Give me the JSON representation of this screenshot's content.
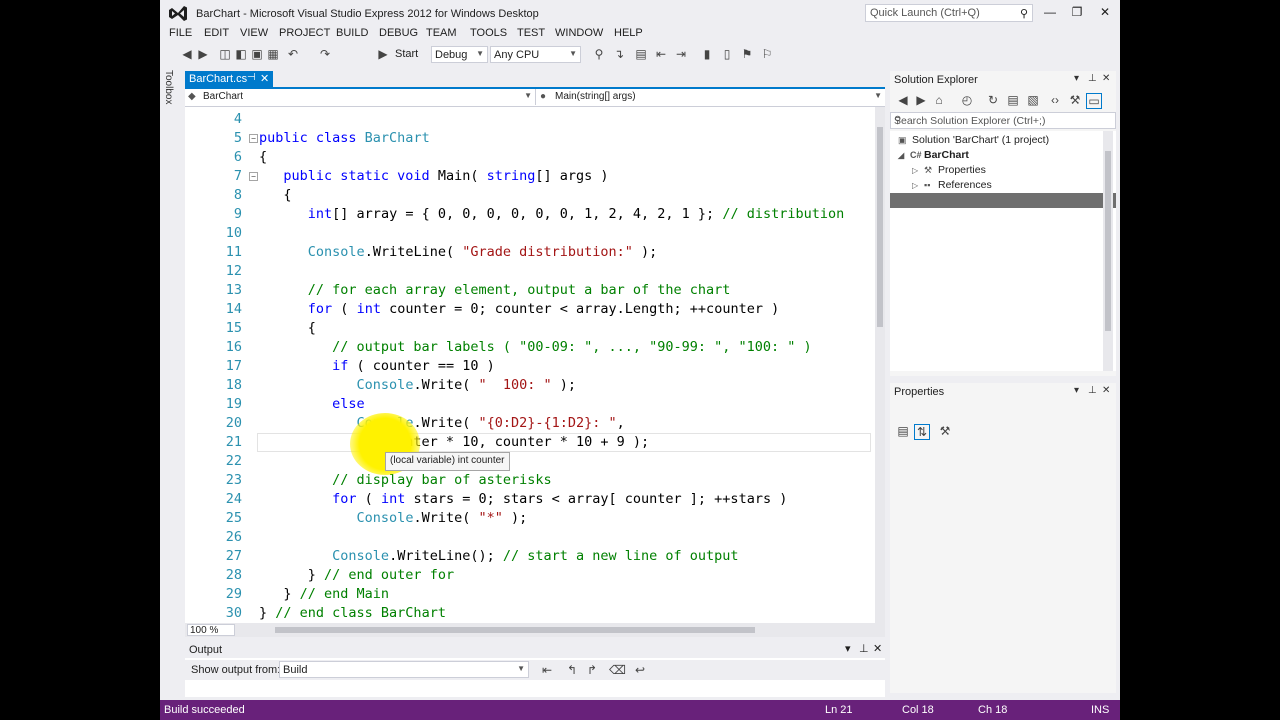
{
  "window": {
    "title": "BarChart - Microsoft Visual Studio Express 2012 for Windows Desktop",
    "quick_launch_placeholder": "Quick Launch (Ctrl+Q)",
    "minimize": "—",
    "restore": "❐",
    "close": "✕"
  },
  "menu": [
    "FILE",
    "EDIT",
    "VIEW",
    "PROJECT",
    "BUILD",
    "DEBUG",
    "TEAM",
    "TOOLS",
    "TEST",
    "WINDOW",
    "HELP"
  ],
  "toolbar": {
    "start_label": "Start",
    "config": "Debug",
    "platform": "Any CPU"
  },
  "toolbox_label": "Toolbox",
  "document_tab": {
    "name": "BarChart.cs",
    "pin": "⊣",
    "close": "✕"
  },
  "navbar": {
    "type": "BarChart",
    "member": "Main(string[] args)"
  },
  "editor": {
    "zoom": "100 %",
    "current_line": 21,
    "tooltip": "(local variable) int counter",
    "lines": [
      {
        "n": "4",
        "fold": "",
        "tokens": []
      },
      {
        "n": "5",
        "fold": "−",
        "tokens": [
          [
            "kw",
            "public class "
          ],
          [
            "ty",
            "BarChart"
          ]
        ]
      },
      {
        "n": "6",
        "fold": "",
        "tokens": [
          [
            "p",
            "{"
          ]
        ]
      },
      {
        "n": "7",
        "fold": "−",
        "tokens": [
          [
            "p",
            "   "
          ],
          [
            "kw",
            "public static void "
          ],
          [
            "p",
            "Main( "
          ],
          [
            "kw",
            "string"
          ],
          [
            "p",
            "[] args )"
          ]
        ]
      },
      {
        "n": "8",
        "fold": "",
        "tokens": [
          [
            "p",
            "   {"
          ]
        ]
      },
      {
        "n": "9",
        "fold": "",
        "tokens": [
          [
            "p",
            "      "
          ],
          [
            "kw",
            "int"
          ],
          [
            "p",
            "[] array = { 0, 0, 0, 0, 0, 0, 1, 2, 4, 2, 1 }; "
          ],
          [
            "cm",
            "// distribution"
          ]
        ]
      },
      {
        "n": "10",
        "fold": "",
        "tokens": []
      },
      {
        "n": "11",
        "fold": "",
        "tokens": [
          [
            "p",
            "      "
          ],
          [
            "ty",
            "Console"
          ],
          [
            "p",
            ".WriteLine( "
          ],
          [
            "st",
            "\"Grade distribution:\""
          ],
          [
            "p",
            " );"
          ]
        ]
      },
      {
        "n": "12",
        "fold": "",
        "tokens": []
      },
      {
        "n": "13",
        "fold": "",
        "tokens": [
          [
            "p",
            "      "
          ],
          [
            "cm",
            "// for each array element, output a bar of the chart"
          ]
        ]
      },
      {
        "n": "14",
        "fold": "",
        "tokens": [
          [
            "p",
            "      "
          ],
          [
            "kw",
            "for"
          ],
          [
            "p",
            " ( "
          ],
          [
            "kw",
            "int"
          ],
          [
            "p",
            " counter = 0; counter < array.Length; ++counter )"
          ]
        ]
      },
      {
        "n": "15",
        "fold": "",
        "tokens": [
          [
            "p",
            "      {"
          ]
        ]
      },
      {
        "n": "16",
        "fold": "",
        "tokens": [
          [
            "p",
            "         "
          ],
          [
            "cm",
            "// output bar labels ( \"00-09: \", ..., \"90-99: \", \"100: \" )"
          ]
        ]
      },
      {
        "n": "17",
        "fold": "",
        "tokens": [
          [
            "p",
            "         "
          ],
          [
            "kw",
            "if"
          ],
          [
            "p",
            " ( counter == 10 )"
          ]
        ]
      },
      {
        "n": "18",
        "fold": "",
        "tokens": [
          [
            "p",
            "            "
          ],
          [
            "ty",
            "Console"
          ],
          [
            "p",
            ".Write( "
          ],
          [
            "st",
            "\"  100: \""
          ],
          [
            "p",
            " );"
          ]
        ]
      },
      {
        "n": "19",
        "fold": "",
        "tokens": [
          [
            "p",
            "         "
          ],
          [
            "kw",
            "else"
          ]
        ]
      },
      {
        "n": "20",
        "fold": "",
        "tokens": [
          [
            "p",
            "            "
          ],
          [
            "ty",
            "Console"
          ],
          [
            "p",
            ".Write( "
          ],
          [
            "st",
            "\"{0:D2}-{1:D2}: \""
          ],
          [
            "p",
            ","
          ]
        ]
      },
      {
        "n": "21",
        "fold": "",
        "tokens": [
          [
            "p",
            "               counter * 10, counter * 10 + 9 );"
          ]
        ]
      },
      {
        "n": "22",
        "fold": "",
        "tokens": []
      },
      {
        "n": "23",
        "fold": "",
        "tokens": [
          [
            "p",
            "         "
          ],
          [
            "cm",
            "// display bar of asterisks"
          ]
        ]
      },
      {
        "n": "24",
        "fold": "",
        "tokens": [
          [
            "p",
            "         "
          ],
          [
            "kw",
            "for"
          ],
          [
            "p",
            " ( "
          ],
          [
            "kw",
            "int"
          ],
          [
            "p",
            " stars = 0; stars < array[ counter ]; ++stars )"
          ]
        ]
      },
      {
        "n": "25",
        "fold": "",
        "tokens": [
          [
            "p",
            "            "
          ],
          [
            "ty",
            "Console"
          ],
          [
            "p",
            ".Write( "
          ],
          [
            "st",
            "\"*\""
          ],
          [
            "p",
            " );"
          ]
        ]
      },
      {
        "n": "26",
        "fold": "",
        "tokens": []
      },
      {
        "n": "27",
        "fold": "",
        "tokens": [
          [
            "p",
            "         "
          ],
          [
            "ty",
            "Console"
          ],
          [
            "p",
            ".WriteLine(); "
          ],
          [
            "cm",
            "// start a new line of output"
          ]
        ]
      },
      {
        "n": "28",
        "fold": "",
        "tokens": [
          [
            "p",
            "      } "
          ],
          [
            "cm",
            "// end outer for"
          ]
        ]
      },
      {
        "n": "29",
        "fold": "",
        "tokens": [
          [
            "p",
            "   } "
          ],
          [
            "cm",
            "// end Main"
          ]
        ]
      },
      {
        "n": "30",
        "fold": "",
        "tokens": [
          [
            "p",
            "} "
          ],
          [
            "cm",
            "// end class BarChart"
          ]
        ]
      }
    ]
  },
  "output": {
    "title": "Output",
    "show_from_label": "Show output from:",
    "show_from_value": "Build"
  },
  "solution_explorer": {
    "title": "Solution Explorer",
    "search_placeholder": "Search Solution Explorer (Ctrl+;)",
    "tree": [
      {
        "label": "Solution 'BarChart' (1 project)",
        "indent": 0,
        "arrow": "",
        "icon": "▣",
        "bold": false
      },
      {
        "label": "BarChart",
        "indent": 1,
        "arrow": "◢",
        "icon": "C#",
        "bold": true
      },
      {
        "label": "Properties",
        "indent": 2,
        "arrow": "▷",
        "icon": "⚒",
        "bold": false
      },
      {
        "label": "References",
        "indent": 2,
        "arrow": "▷",
        "icon": "▪▪",
        "bold": false
      }
    ]
  },
  "properties": {
    "title": "Properties"
  },
  "status": {
    "message": "Build succeeded",
    "line": "Ln 21",
    "col": "Col 18",
    "ch": "Ch 18",
    "mode": "INS"
  },
  "colors": {
    "accent": "#007acc",
    "statusbar": "#68217a",
    "keyword": "#0000ff",
    "comment": "#008000",
    "string": "#a31515",
    "type": "#2b91af",
    "highlight": "#fff200"
  }
}
